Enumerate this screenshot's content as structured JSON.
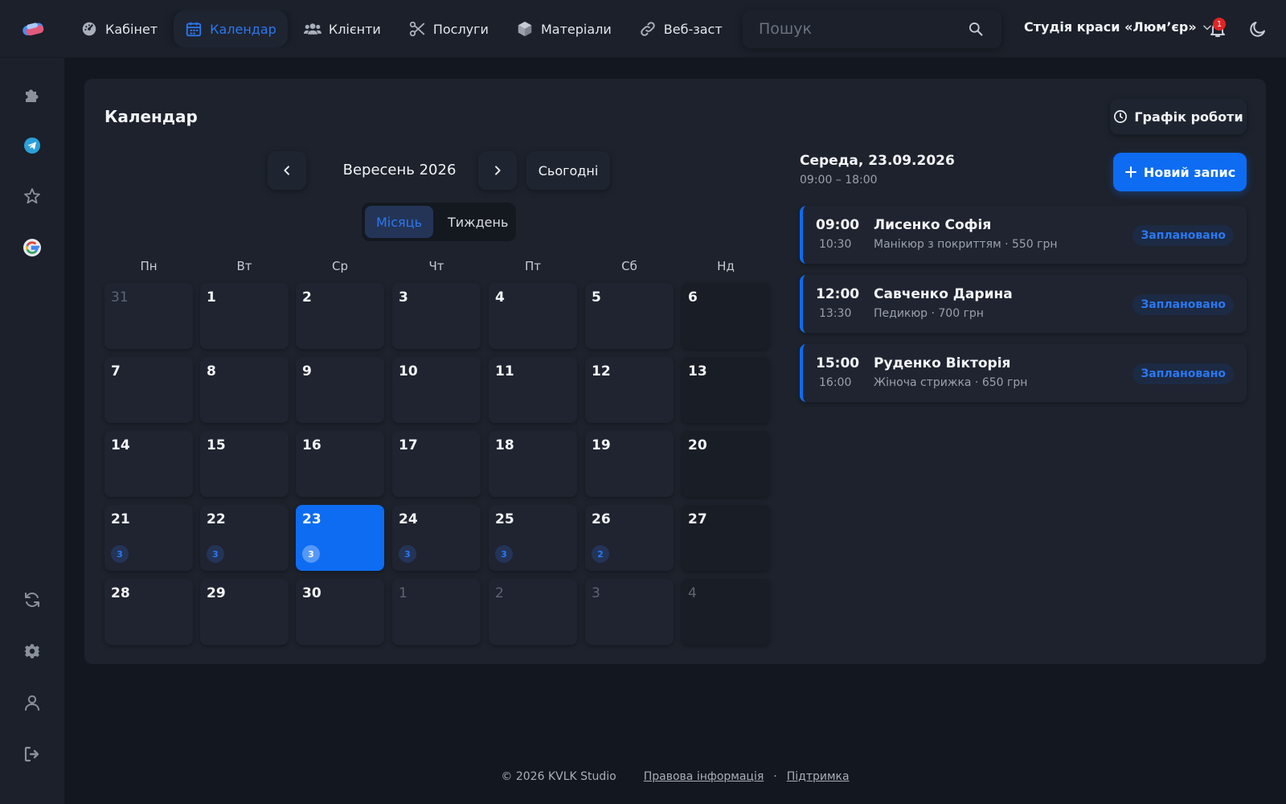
{
  "nav": {
    "items": [
      {
        "label": "Кабінет",
        "icon": "dashboard-icon"
      },
      {
        "label": "Календар",
        "icon": "calendar-icon"
      },
      {
        "label": "Клієнти",
        "icon": "users-icon"
      },
      {
        "label": "Послуги",
        "icon": "scissors-icon"
      },
      {
        "label": "Матеріали",
        "icon": "box-icon"
      },
      {
        "label": "Веб-заст",
        "icon": "link-icon"
      }
    ],
    "active_index": 1
  },
  "search": {
    "placeholder": "Пошук"
  },
  "studio": {
    "name": "Студія краси «Люм’єр»"
  },
  "notifications": {
    "count": "1"
  },
  "sidebar": {
    "icons": [
      "puzzle-icon",
      "telegram-icon",
      "star-icon",
      "google-icon",
      "refresh-icon",
      "settings-icon",
      "profile-icon",
      "logout-icon"
    ]
  },
  "page": {
    "title": "Календар",
    "schedule_button": "Графік роботи"
  },
  "calendar": {
    "month_label": "Вересень 2026",
    "today_button": "Сьогодні",
    "views": [
      "Місяць",
      "Тиждень"
    ],
    "active_view": "Місяць",
    "weekdays": [
      "Пн",
      "Вт",
      "Ср",
      "Чт",
      "Пт",
      "Сб",
      "Нд"
    ],
    "weeks": [
      [
        {
          "d": "31",
          "m": true
        },
        {
          "d": "1"
        },
        {
          "d": "2"
        },
        {
          "d": "3"
        },
        {
          "d": "4"
        },
        {
          "d": "5"
        },
        {
          "d": "6"
        }
      ],
      [
        {
          "d": "7"
        },
        {
          "d": "8"
        },
        {
          "d": "9"
        },
        {
          "d": "10"
        },
        {
          "d": "11"
        },
        {
          "d": "12"
        },
        {
          "d": "13"
        }
      ],
      [
        {
          "d": "14"
        },
        {
          "d": "15"
        },
        {
          "d": "16"
        },
        {
          "d": "17"
        },
        {
          "d": "18"
        },
        {
          "d": "19"
        },
        {
          "d": "20"
        }
      ],
      [
        {
          "d": "21",
          "c": "3"
        },
        {
          "d": "22",
          "c": "3"
        },
        {
          "d": "23",
          "c": "3",
          "today": true
        },
        {
          "d": "24",
          "c": "3"
        },
        {
          "d": "25",
          "c": "3"
        },
        {
          "d": "26",
          "c": "2"
        },
        {
          "d": "27"
        }
      ],
      [
        {
          "d": "28"
        },
        {
          "d": "29"
        },
        {
          "d": "30"
        },
        {
          "d": "1",
          "m": true
        },
        {
          "d": "2",
          "m": true
        },
        {
          "d": "3",
          "m": true
        },
        {
          "d": "4",
          "m": true
        }
      ]
    ]
  },
  "day_panel": {
    "title": "Середа, 23.09.2026",
    "hours": "09:00 – 18:00",
    "new_button": "Новий запис",
    "appointments": [
      {
        "start": "09:00",
        "end": "10:30",
        "name": "Лисенко Софія",
        "desc": "Манікюр з покриттям · 550 грн",
        "status": "Заплановано"
      },
      {
        "start": "12:00",
        "end": "13:30",
        "name": "Савченко Дарина",
        "desc": "Педикюр · 700 грн",
        "status": "Заплановано"
      },
      {
        "start": "15:00",
        "end": "16:00",
        "name": "Руденко Вікторія",
        "desc": "Жіноча стрижка · 650 грн",
        "status": "Заплановано"
      }
    ]
  },
  "footer": {
    "copyright": "© 2026 KVLK Studio",
    "legal": "Правова інформація",
    "separator": "·",
    "support": "Підтримка"
  },
  "colors": {
    "accent": "#0d6cf2",
    "badge": "#e02424",
    "background": "#131720",
    "surface": "#1d222c"
  }
}
